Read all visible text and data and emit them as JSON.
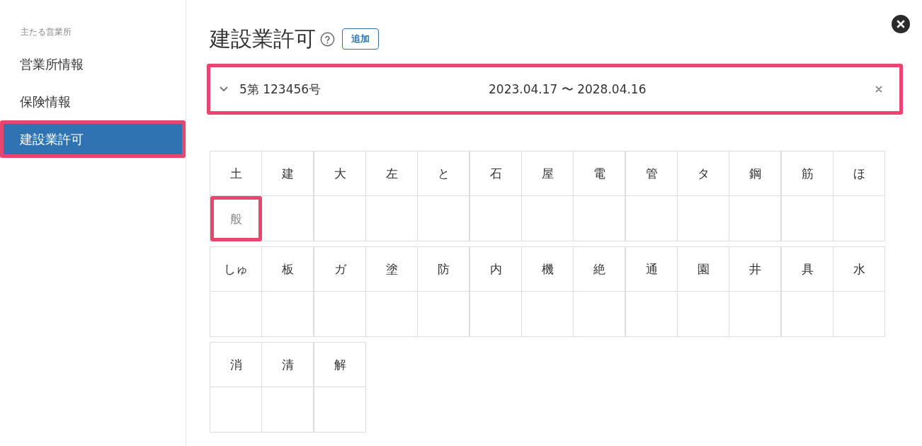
{
  "sidebar": {
    "section_label": "主たる営業所",
    "items": [
      {
        "label": "営業所情報",
        "selected": false,
        "highlighted": false
      },
      {
        "label": "保険情報",
        "selected": false,
        "highlighted": false
      },
      {
        "label": "建設業許可",
        "selected": true,
        "highlighted": true
      }
    ]
  },
  "header": {
    "title": "建設業許可",
    "add_button": "追加"
  },
  "licenses": [
    {
      "number": "5第 123456号",
      "period": "2023.04.17 〜 2028.04.16",
      "expanded": false,
      "highlighted": true
    }
  ],
  "trade_table": {
    "rows": [
      {
        "groups": [
          {
            "cells": [
              {
                "label": "土",
                "grade": "般",
                "dimmed": true,
                "highlighted": true
              },
              {
                "label": "建",
                "highlighted": false
              }
            ]
          },
          {
            "cells": [
              {
                "label": "大",
                "highlighted": false
              },
              {
                "label": "左",
                "highlighted": false
              },
              {
                "label": "と",
                "highlighted": false
              }
            ]
          },
          {
            "cells": [
              {
                "label": "石",
                "highlighted": false
              },
              {
                "label": "屋",
                "highlighted": false
              },
              {
                "label": "電",
                "highlighted": false
              }
            ]
          },
          {
            "cells": [
              {
                "label": "管",
                "highlighted": false
              },
              {
                "label": "タ",
                "highlighted": false
              },
              {
                "label": "鋼",
                "highlighted": false
              }
            ]
          },
          {
            "cells": [
              {
                "label": "筋",
                "highlighted": false
              },
              {
                "label": "ほ",
                "highlighted": false
              }
            ]
          }
        ]
      },
      {
        "groups": [
          {
            "cells": [
              {
                "label": "しゅ",
                "highlighted": false
              },
              {
                "label": "板",
                "highlighted": false
              }
            ]
          },
          {
            "cells": [
              {
                "label": "ガ",
                "highlighted": false
              },
              {
                "label": "塗",
                "highlighted": false
              },
              {
                "label": "防",
                "highlighted": false
              }
            ]
          },
          {
            "cells": [
              {
                "label": "内",
                "highlighted": false
              },
              {
                "label": "機",
                "highlighted": false
              },
              {
                "label": "絶",
                "highlighted": false
              }
            ]
          },
          {
            "cells": [
              {
                "label": "通",
                "highlighted": false
              },
              {
                "label": "園",
                "highlighted": false
              },
              {
                "label": "井",
                "highlighted": false
              }
            ]
          },
          {
            "cells": [
              {
                "label": "具",
                "highlighted": false
              },
              {
                "label": "水",
                "highlighted": false
              }
            ]
          }
        ]
      },
      {
        "groups": [
          {
            "cells": [
              {
                "label": "消",
                "highlighted": false
              },
              {
                "label": "清",
                "highlighted": false
              }
            ]
          },
          {
            "cells": [
              {
                "label": "解",
                "highlighted": false
              }
            ]
          }
        ]
      }
    ]
  }
}
